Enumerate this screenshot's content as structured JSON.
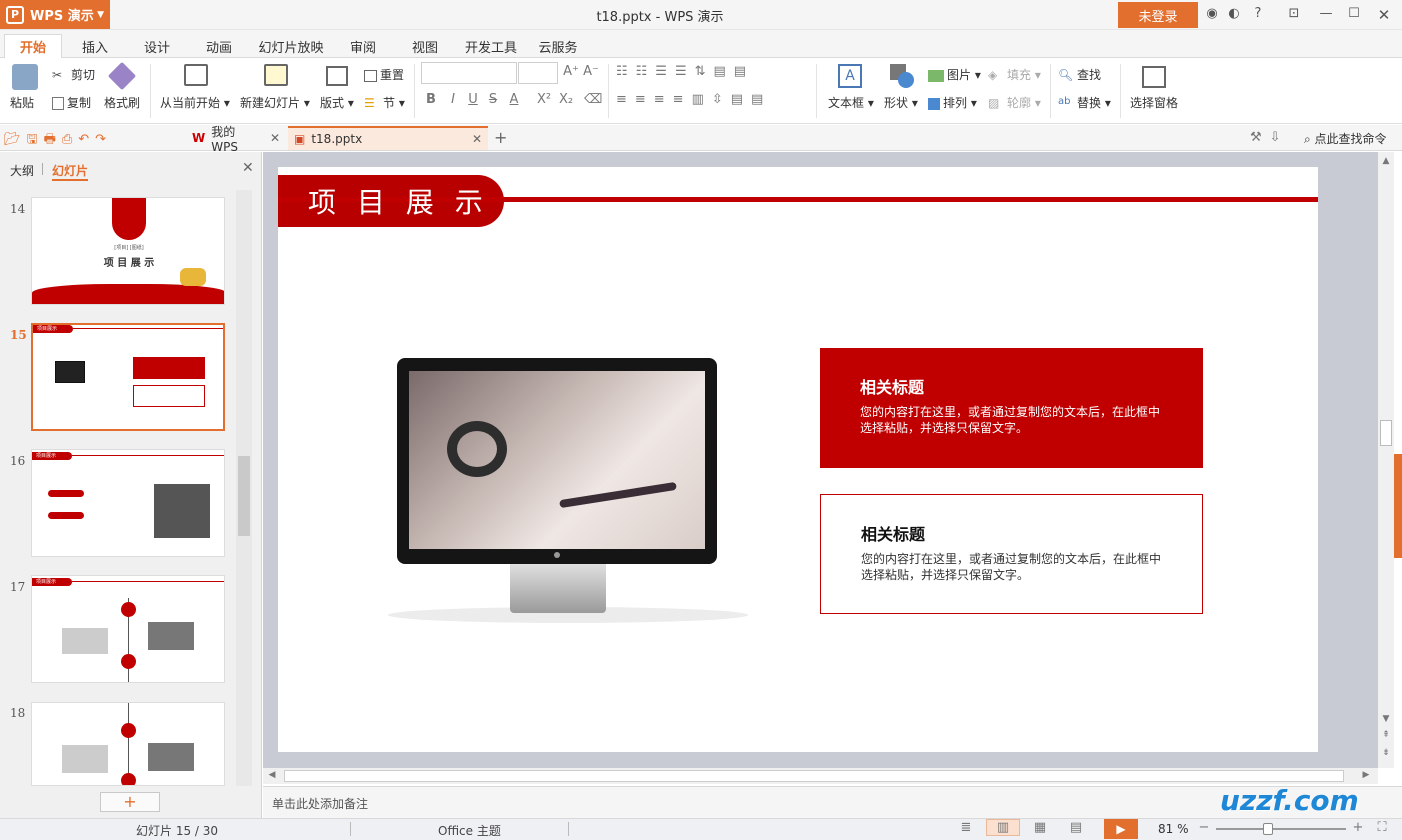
{
  "app": {
    "name": "WPS 演示",
    "logo_glyph": "P",
    "doc_title": "t18.pptx - WPS 演示",
    "login": "未登录"
  },
  "title_icons": [
    "shield-icon",
    "share-icon",
    "help-icon",
    "skin-icon",
    "minimize-icon",
    "maximize-icon",
    "close-icon"
  ],
  "tabs": [
    "开始",
    "插入",
    "设计",
    "动画",
    "幻灯片放映",
    "审阅",
    "视图",
    "开发工具",
    "云服务"
  ],
  "ribbon": {
    "paste": "粘贴",
    "cut": "剪切",
    "copy": "复制",
    "format_painter": "格式刷",
    "from_current": "从当前开始",
    "new_slide": "新建幻灯片",
    "layout": "版式",
    "reset": "重置",
    "section": "节",
    "textbox": "文本框",
    "shape": "形状",
    "picture": "图片",
    "arrange": "排列",
    "fill": "填充",
    "outline": "轮廓",
    "find": "查找",
    "replace": "替换",
    "select_pane": "选择窗格",
    "font_grow": "A⁺",
    "font_shrink": "A⁻",
    "bold": "B",
    "italic": "I",
    "underline": "U",
    "strike": "S",
    "font_color": "A",
    "superscript": "X²",
    "subscript": "X₂"
  },
  "quick": {
    "my_wps": "我的WPS",
    "doc_tab": "t18.pptx",
    "add_tab": "+",
    "find_cmd": "点此查找命令"
  },
  "leftpane": {
    "outline_tab": "大纲",
    "slides_tab": "幻灯片",
    "add": "+",
    "slides": [
      {
        "num": "14",
        "title": "项 目 展 示",
        "small": "[项目] [图纸]"
      },
      {
        "num": "15",
        "header": "项目展示"
      },
      {
        "num": "16",
        "header": "项目展示"
      },
      {
        "num": "17",
        "header": "项目展示"
      },
      {
        "num": "18",
        "header": ""
      }
    ]
  },
  "slide": {
    "title": "项 目 展 示",
    "box1": {
      "heading": "相关标题",
      "body": "您的内容打在这里，或者通过复制您的文本后，在此框中选择粘贴，并选择只保留文字。"
    },
    "box2": {
      "heading": "相关标题",
      "body": "您的内容打在这里，或者通过复制您的文本后，在此框中选择粘贴，并选择只保留文字。"
    }
  },
  "notes_placeholder": "单击此处添加备注",
  "status": {
    "slide_index": "幻灯片 15 / 30",
    "theme": "Office 主题",
    "zoom": "81 %"
  },
  "watermark": "uzzf.com",
  "colors": {
    "accent": "#e36f2e",
    "slide_red": "#c00000"
  }
}
